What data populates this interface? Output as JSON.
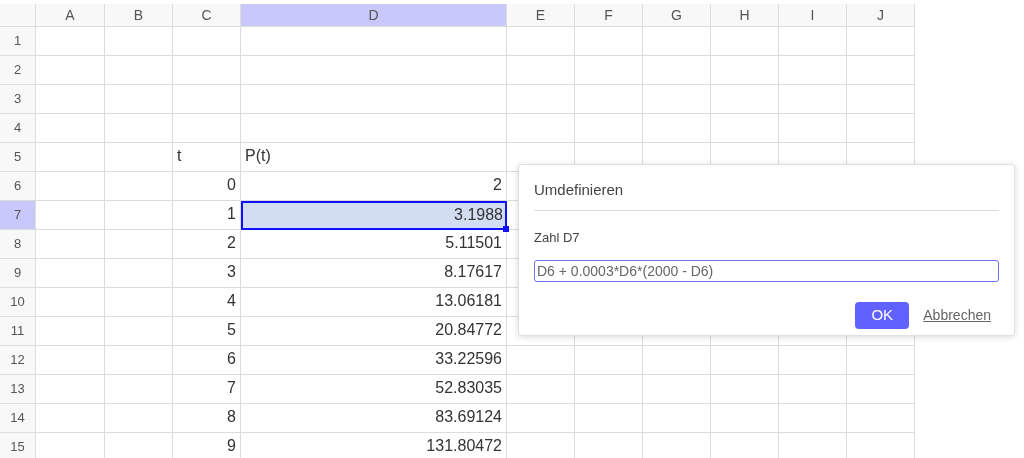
{
  "columns": [
    {
      "label": "A",
      "selected": false
    },
    {
      "label": "B",
      "selected": false
    },
    {
      "label": "C",
      "selected": false
    },
    {
      "label": "D",
      "selected": true
    },
    {
      "label": "E",
      "selected": false
    },
    {
      "label": "F",
      "selected": false
    },
    {
      "label": "G",
      "selected": false
    },
    {
      "label": "H",
      "selected": false
    },
    {
      "label": "I",
      "selected": false
    },
    {
      "label": "J",
      "selected": false
    }
  ],
  "rows": [
    {
      "label": "1",
      "selected": false,
      "kind": "empty"
    },
    {
      "label": "2",
      "selected": false,
      "kind": "empty"
    },
    {
      "label": "3",
      "selected": false,
      "kind": "empty"
    },
    {
      "label": "4",
      "selected": false,
      "kind": "empty"
    },
    {
      "label": "5",
      "selected": false,
      "kind": "text",
      "column_c": "t",
      "column_d": "P(t)"
    },
    {
      "label": "6",
      "selected": false,
      "kind": "number",
      "column_c": "0",
      "column_d": "2"
    },
    {
      "label": "7",
      "selected": true,
      "kind": "number",
      "column_c": "1",
      "column_d": "3.1988"
    },
    {
      "label": "8",
      "selected": false,
      "kind": "number",
      "column_c": "2",
      "column_d": "5.11501"
    },
    {
      "label": "9",
      "selected": false,
      "kind": "number",
      "column_c": "3",
      "column_d": "8.17617"
    },
    {
      "label": "10",
      "selected": false,
      "kind": "number",
      "column_c": "4",
      "column_d": "13.06181"
    },
    {
      "label": "11",
      "selected": false,
      "kind": "number",
      "column_c": "5",
      "column_d": "20.84772"
    },
    {
      "label": "12",
      "selected": false,
      "kind": "number",
      "column_c": "6",
      "column_d": "33.22596"
    },
    {
      "label": "13",
      "selected": false,
      "kind": "number",
      "column_c": "7",
      "column_d": "52.83035"
    },
    {
      "label": "14",
      "selected": false,
      "kind": "number",
      "column_c": "8",
      "column_d": "83.69124"
    },
    {
      "label": "15",
      "selected": false,
      "kind": "number",
      "column_c": "9",
      "column_d": "131.80472"
    }
  ],
  "dialog": {
    "title": "Umdefinieren",
    "label": "Zahl D7",
    "value": "D6 + 0.0003*D6*(2000 - D6)",
    "ok": "OK",
    "cancel": "Abbrechen"
  }
}
